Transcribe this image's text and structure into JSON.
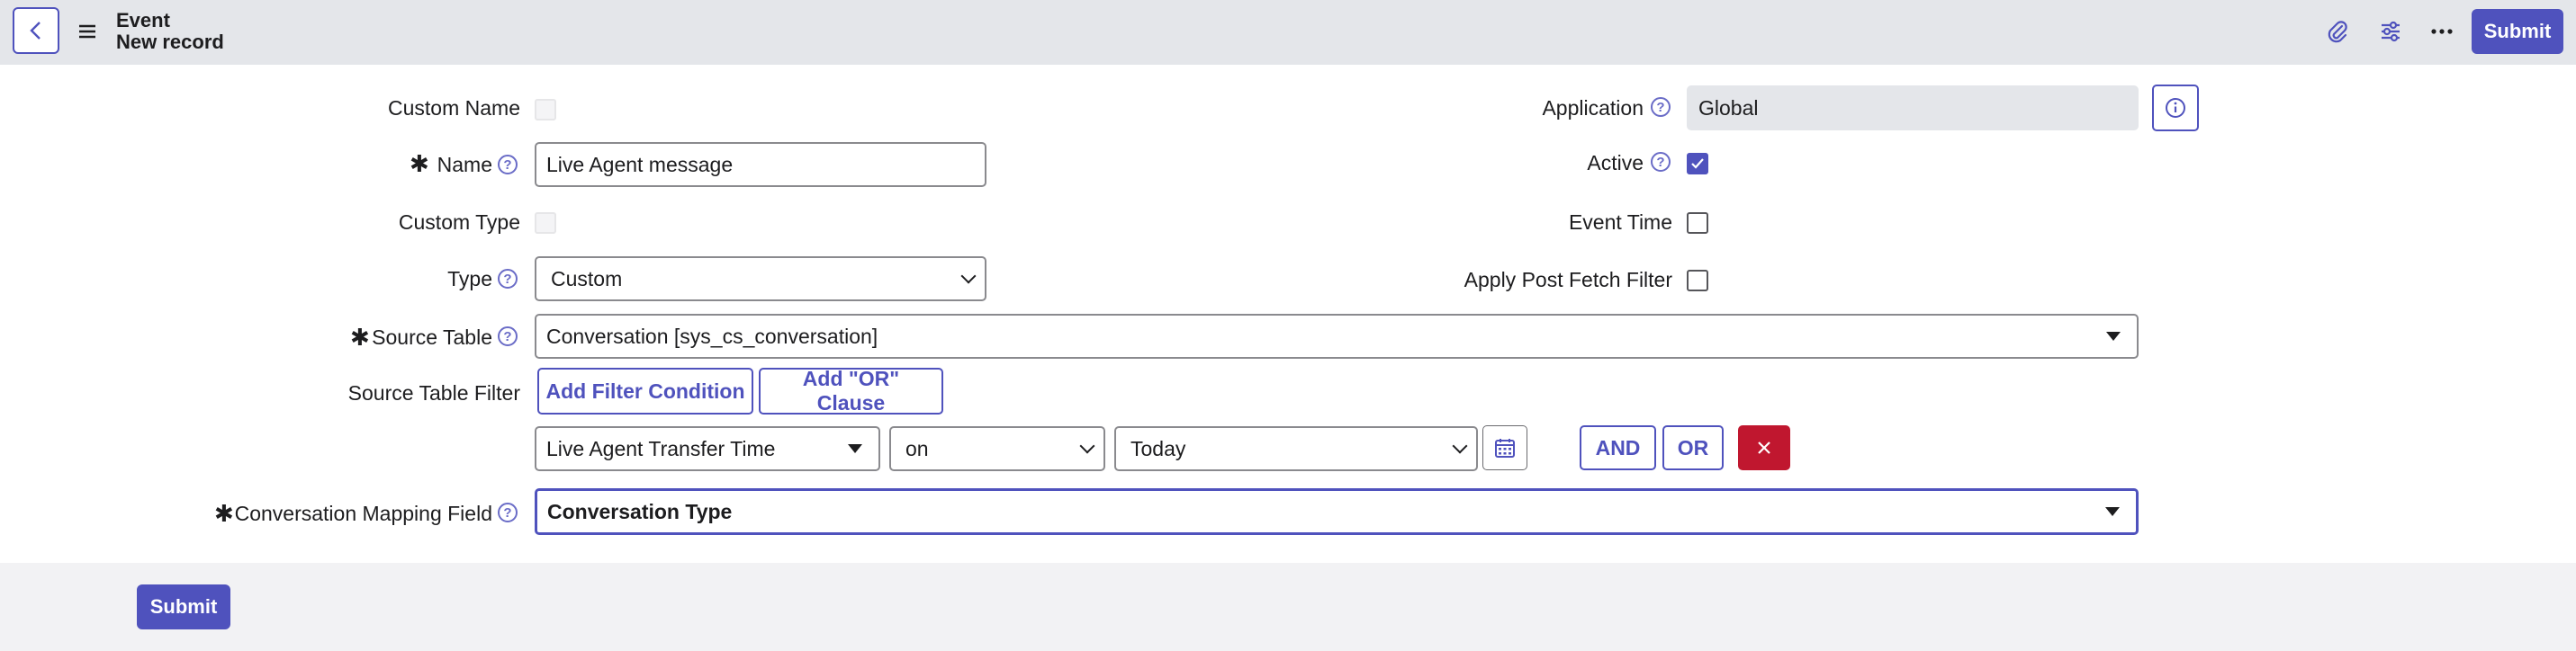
{
  "header": {
    "title": "Event",
    "subtitle": "New record",
    "submit_label": "Submit"
  },
  "fields": {
    "custom_name": {
      "label": "Custom Name"
    },
    "name": {
      "label": "Name",
      "value": "Live Agent message"
    },
    "custom_type": {
      "label": "Custom Type"
    },
    "type": {
      "label": "Type",
      "value": "Custom"
    },
    "source_table": {
      "label": "Source Table",
      "value": "Conversation [sys_cs_conversation]"
    },
    "source_table_filter": {
      "label": "Source Table Filter"
    },
    "conversation_mapping_field": {
      "label": "Conversation Mapping Field",
      "value": "Conversation Type"
    },
    "application": {
      "label": "Application",
      "value": "Global"
    },
    "active": {
      "label": "Active",
      "checked": true
    },
    "event_time": {
      "label": "Event Time",
      "checked": false
    },
    "apply_post_fetch_filter": {
      "label": "Apply Post Fetch Filter",
      "checked": false
    }
  },
  "filter": {
    "add_condition_label": "Add Filter Condition",
    "add_or_label": "Add \"OR\" Clause",
    "field_value": "Live Agent Transfer Time",
    "operator_value": "on",
    "date_value": "Today",
    "and_label": "AND",
    "or_label": "OR"
  },
  "footer": {
    "submit_label": "Submit"
  },
  "colors": {
    "accent": "#4f52bd",
    "danger": "#c0172f",
    "header_bg": "#e4e6ea"
  }
}
